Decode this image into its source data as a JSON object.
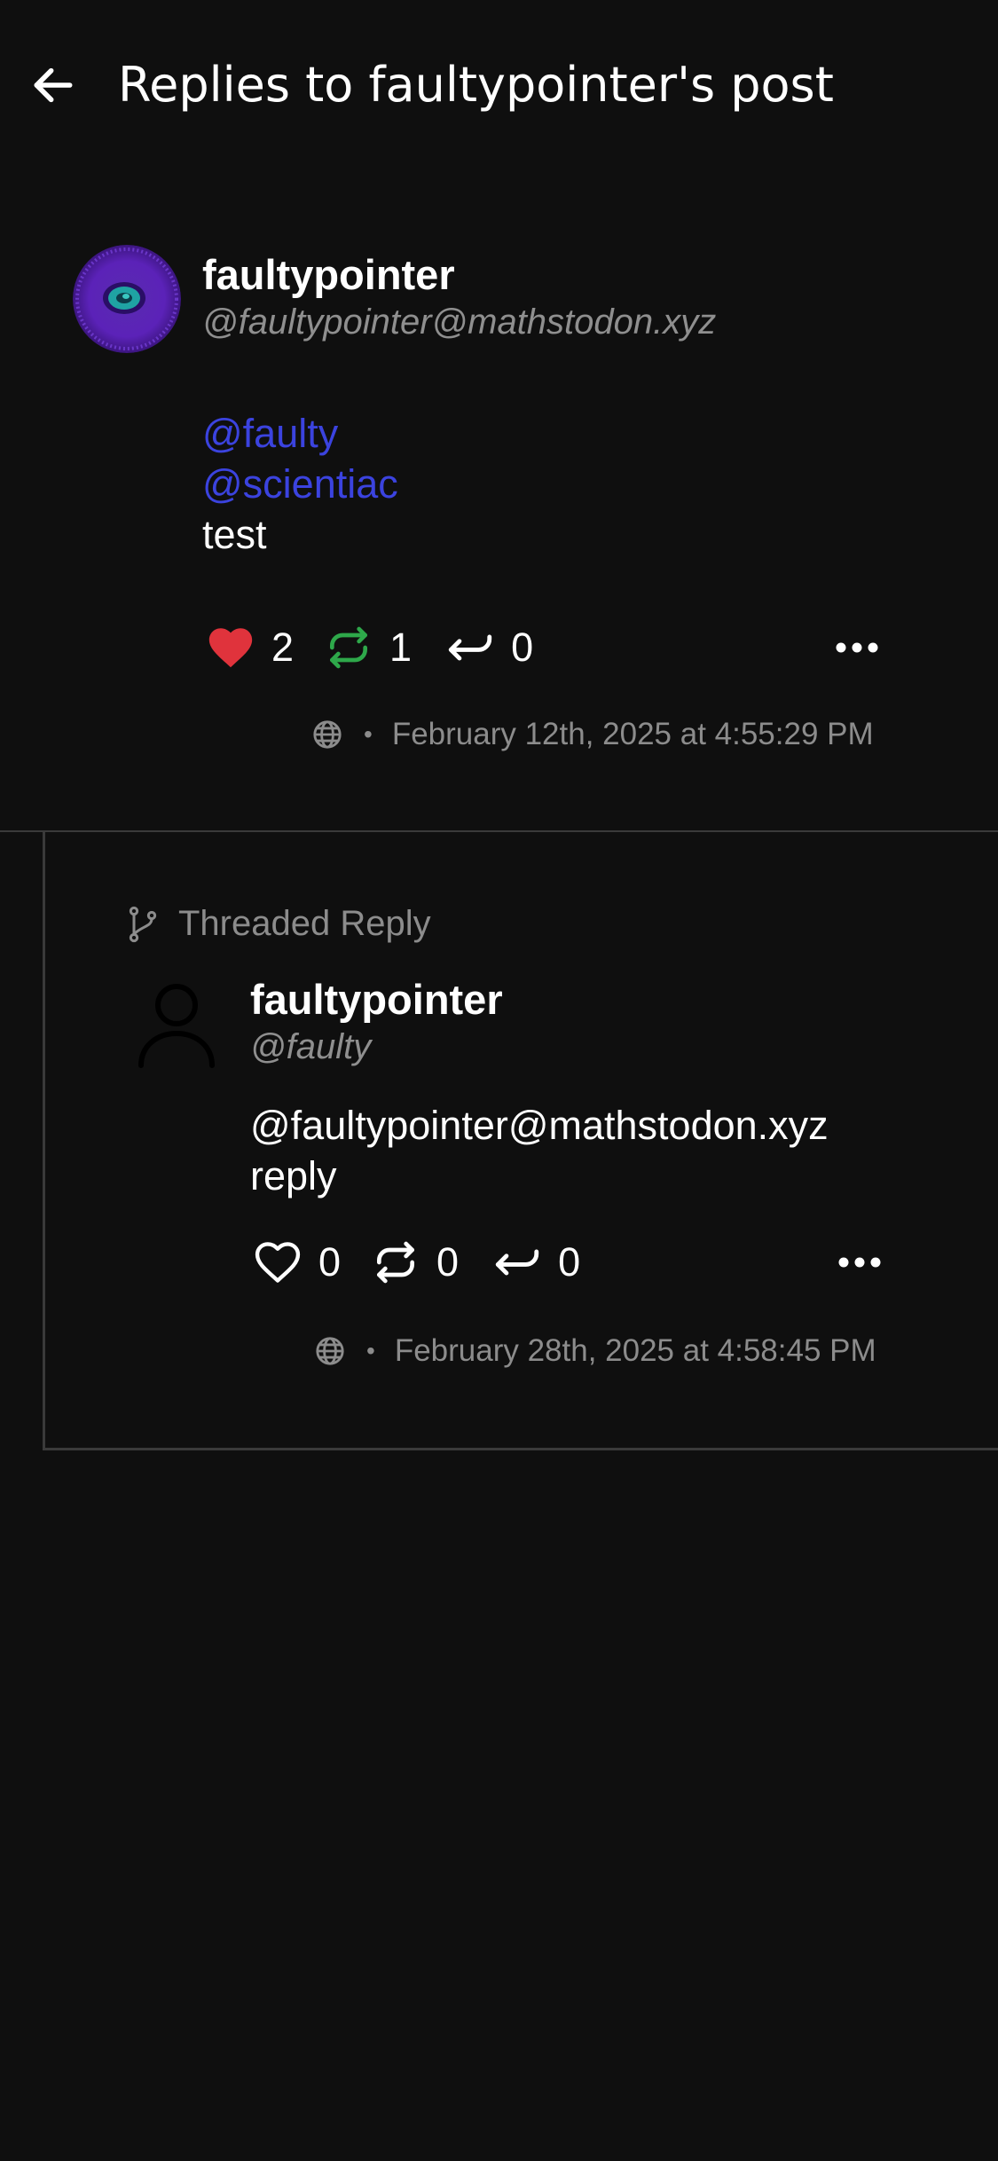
{
  "header": {
    "title": "Replies to faultypointer's post",
    "back_icon": "arrow-left-icon"
  },
  "post": {
    "author_name": "faultypointer",
    "author_handle": "@faultypointer@mathstodon.xyz",
    "mentions": [
      "@faulty",
      "@scientiac"
    ],
    "text": "test",
    "likes": "2",
    "boosts": "1",
    "replies": "0",
    "liked": true,
    "boosted": true,
    "visibility_icon": "globe-icon",
    "timestamp": "February 12th, 2025 at 4:55:29 PM"
  },
  "thread": {
    "label": "Threaded Reply",
    "reply": {
      "author_name": "faultypointer",
      "author_handle": "@faulty",
      "text_line1": "@faultypointer@mathstodon.xyz",
      "text_line2": "reply",
      "likes": "0",
      "boosts": "0",
      "replies": "0",
      "visibility_icon": "globe-icon",
      "timestamp": "February 28th, 2025 at 4:58:45 PM"
    }
  },
  "separator": "•",
  "colors": {
    "background": "#0f0f0f",
    "mention": "#3b43df",
    "like_active": "#e0333c",
    "boost_active": "#2ea84a",
    "muted_text": "#8c8c8c"
  }
}
